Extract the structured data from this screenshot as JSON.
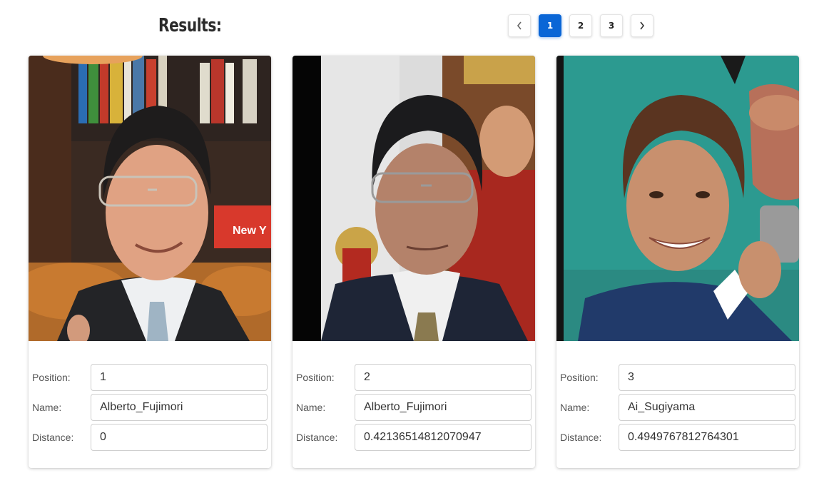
{
  "header": {
    "title": "Results:"
  },
  "pagination": {
    "prev_icon": "chevron-left-icon",
    "next_icon": "chevron-right-icon",
    "pages": [
      "1",
      "2",
      "3"
    ],
    "active_page": "1",
    "accent_color": "#0a66d6"
  },
  "labels": {
    "position": "Position:",
    "name": "Name:",
    "distance": "Distance:"
  },
  "results": [
    {
      "position": "1",
      "name": "Alberto_Fujimori",
      "distance": "0",
      "photo": "man-in-suit-photo"
    },
    {
      "position": "2",
      "name": "Alberto_Fujimori",
      "distance": "0.42136514812070947",
      "photo": "man-in-suit-photo"
    },
    {
      "position": "3",
      "name": "Ai_Sugiyama",
      "distance": "0.4949767812764301",
      "photo": "woman-with-trophy-photo"
    }
  ]
}
